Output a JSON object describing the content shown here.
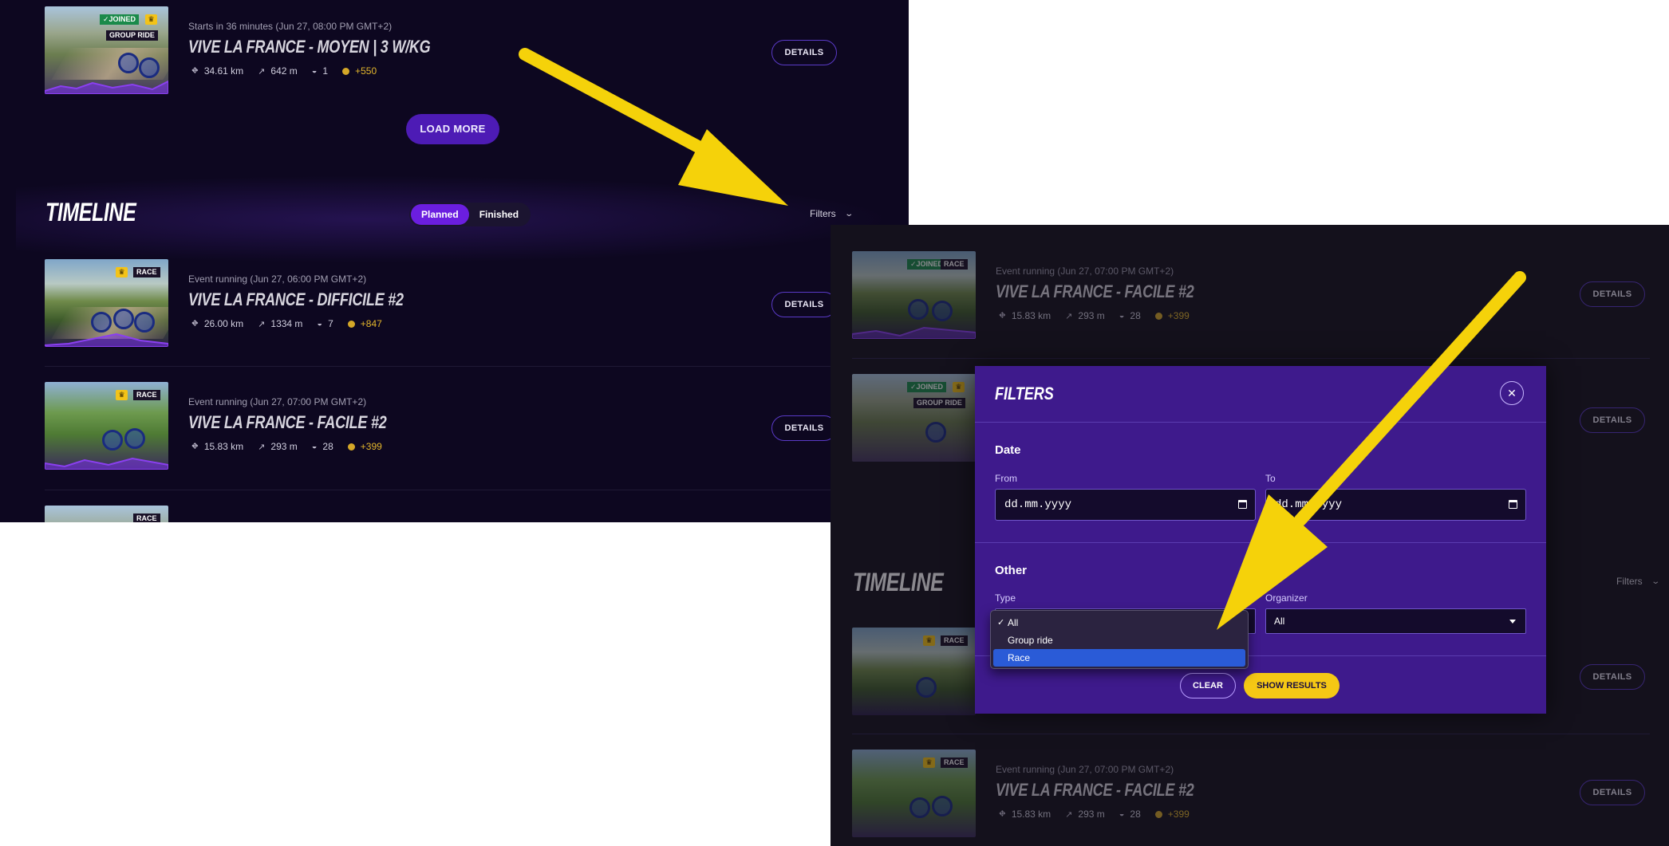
{
  "panel_a": {
    "top_event": {
      "time": "Starts in 36 minutes (Jun 27, 08:00 PM GMT+2)",
      "title": "VIVE LA FRANCE - MOYEN |  3 W/KG",
      "distance": "34.61 km",
      "elevation": "642 m",
      "participants": "1",
      "points": "+550",
      "badge_joined": "JOINED",
      "badge_type": "GROUP RIDE",
      "details": "DETAILS"
    },
    "load_more": "LOAD MORE",
    "timeline_title": "TIMELINE",
    "tabs": [
      "Planned",
      "Finished"
    ],
    "filters_label": "Filters",
    "events": [
      {
        "badge_type": "RACE",
        "time": "Event running (Jun 27, 06:00 PM GMT+2)",
        "title": "VIVE LA FRANCE - DIFFICILE #2",
        "distance": "26.00 km",
        "elevation": "1334 m",
        "participants": "7",
        "points": "+847",
        "details": "DETAILS"
      },
      {
        "badge_type": "RACE",
        "time": "Event running (Jun 27, 07:00 PM GMT+2)",
        "title": "VIVE LA FRANCE - FACILE #2",
        "distance": "15.83 km",
        "elevation": "293 m",
        "participants": "28",
        "points": "+399",
        "details": "DETAILS"
      },
      {
        "badge_type": "RACE"
      }
    ]
  },
  "panel_b": {
    "events_top": [
      {
        "badge_joined": "JOINED",
        "badge_type": "RACE",
        "time": "Event running (Jun 27, 07:00 PM GMT+2)",
        "title": "VIVE LA FRANCE - FACILE #2",
        "distance": "15.83 km",
        "elevation": "293 m",
        "participants": "28",
        "points": "+399",
        "details": "DETAILS"
      },
      {
        "badge_joined": "JOINED",
        "badge_type": "GROUP RIDE",
        "details": "DETAILS"
      }
    ],
    "timeline_title": "TIMELINE",
    "filters_label": "Filters",
    "events_bottom": [
      {
        "badge_type": "RACE",
        "details": "DETAILS"
      },
      {
        "badge_type": "RACE",
        "time": "Event running (Jun 27, 07:00 PM GMT+2)",
        "title": "VIVE LA FRANCE - FACILE #2",
        "distance": "15.83 km",
        "elevation": "293 m",
        "participants": "28",
        "points": "+399",
        "details": "DETAILS"
      }
    ],
    "modal": {
      "title": "FILTERS",
      "date_section": "Date",
      "from_label": "From",
      "from_placeholder": "dd.mm.yyyy",
      "to_label": "To",
      "to_placeholder": "dd.mm.yyyy",
      "other_section": "Other",
      "type_label": "Type",
      "organizer_label": "Organizer",
      "organizer_value": "All",
      "clear": "CLEAR",
      "show_results": "SHOW RESULTS"
    },
    "type_dropdown": {
      "options": [
        "All",
        "Group ride",
        "Race"
      ],
      "checked": "All",
      "highlighted": "Race"
    }
  },
  "colors": {
    "panel_a_bg": "#0d0720",
    "panel_b_bg": "#14111c",
    "accent_purple": "#6b1ee0",
    "modal_bg": "#3e1a8c",
    "cta_yellow": "#f5c815",
    "arrow_yellow": "#f5d20a",
    "highlight_blue": "#2a5bd7"
  }
}
